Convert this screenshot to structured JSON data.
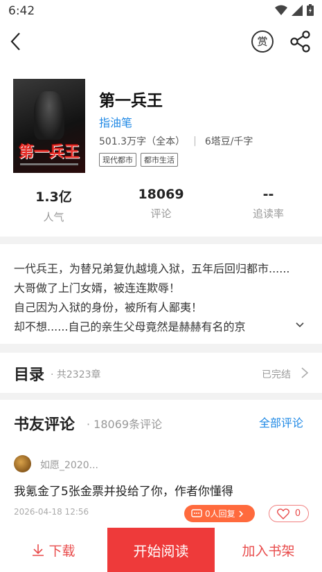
{
  "status": {
    "time": "6:42"
  },
  "nav": {
    "reward_label": "赏"
  },
  "book": {
    "cover_title": "第一兵王",
    "title": "第一兵王",
    "author": "指油笔",
    "word_count": "501.3万字（全本）",
    "price": "6塔豆/千字",
    "tags": [
      "现代都市",
      "都市生活"
    ],
    "stats": [
      {
        "value": "1.3亿",
        "label": "人气"
      },
      {
        "value": "18069",
        "label": "评论"
      },
      {
        "value": "--",
        "label": "追读率"
      }
    ]
  },
  "intro": {
    "lines": [
      "一代兵王，为替兄弟复仇越境入狱，五年后回归都市......",
      "大哥做了上门女婿，被连连欺辱！",
      "自己因为入狱的身份，被所有人鄙夷！",
      "却不想......自己的亲生父母竟然是赫赫有名的京"
    ]
  },
  "catalog": {
    "title": "目录",
    "count": "· 共2323章",
    "status": "已完结"
  },
  "comments": {
    "title": "书友评论",
    "count": "· 18069条评论",
    "all_label": "全部评论",
    "items": [
      {
        "user": "如愿_2020...",
        "text": "我氪金了5张金票并投给了你，作者你懂得",
        "date": "2026-04-18 12:56",
        "reply_label": "0人回复",
        "likes": "0"
      }
    ]
  },
  "bottom": {
    "download": "下载",
    "read": "开始阅读",
    "shelf": "加入书架"
  },
  "colors": {
    "accent": "#ee3a3a",
    "link": "#1e88e5",
    "reply": "#ff6a3d"
  }
}
